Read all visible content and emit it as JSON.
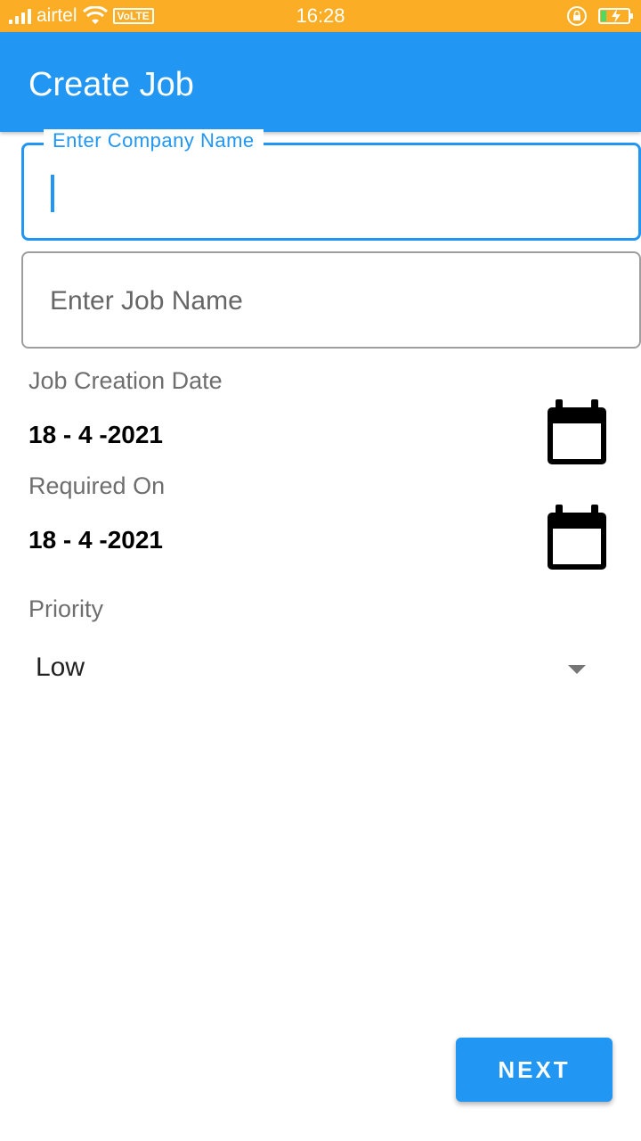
{
  "status_bar": {
    "carrier": "airtel",
    "volte": "VoLTE",
    "time": "16:28",
    "background": "#FBAE25",
    "battery_color": "#4CD964",
    "icons": [
      "signal-icon",
      "wifi-icon",
      "rotation-lock-icon",
      "battery-charging-icon"
    ]
  },
  "app_bar": {
    "title": "Create Job",
    "color": "#2196F3"
  },
  "form": {
    "company": {
      "label": "Enter Company Name",
      "value": ""
    },
    "job_name": {
      "placeholder": "Enter Job Name",
      "value": ""
    },
    "creation_date": {
      "label": "Job Creation Date",
      "value": "18 - 4 -2021",
      "icon": "calendar-icon"
    },
    "required_on": {
      "label": "Required On",
      "value": "18 - 4 -2021",
      "icon": "calendar-icon"
    },
    "priority": {
      "label": "Priority",
      "selected": "Low",
      "icon": "dropdown-arrow-icon"
    }
  },
  "actions": {
    "next_label": "NEXT"
  }
}
